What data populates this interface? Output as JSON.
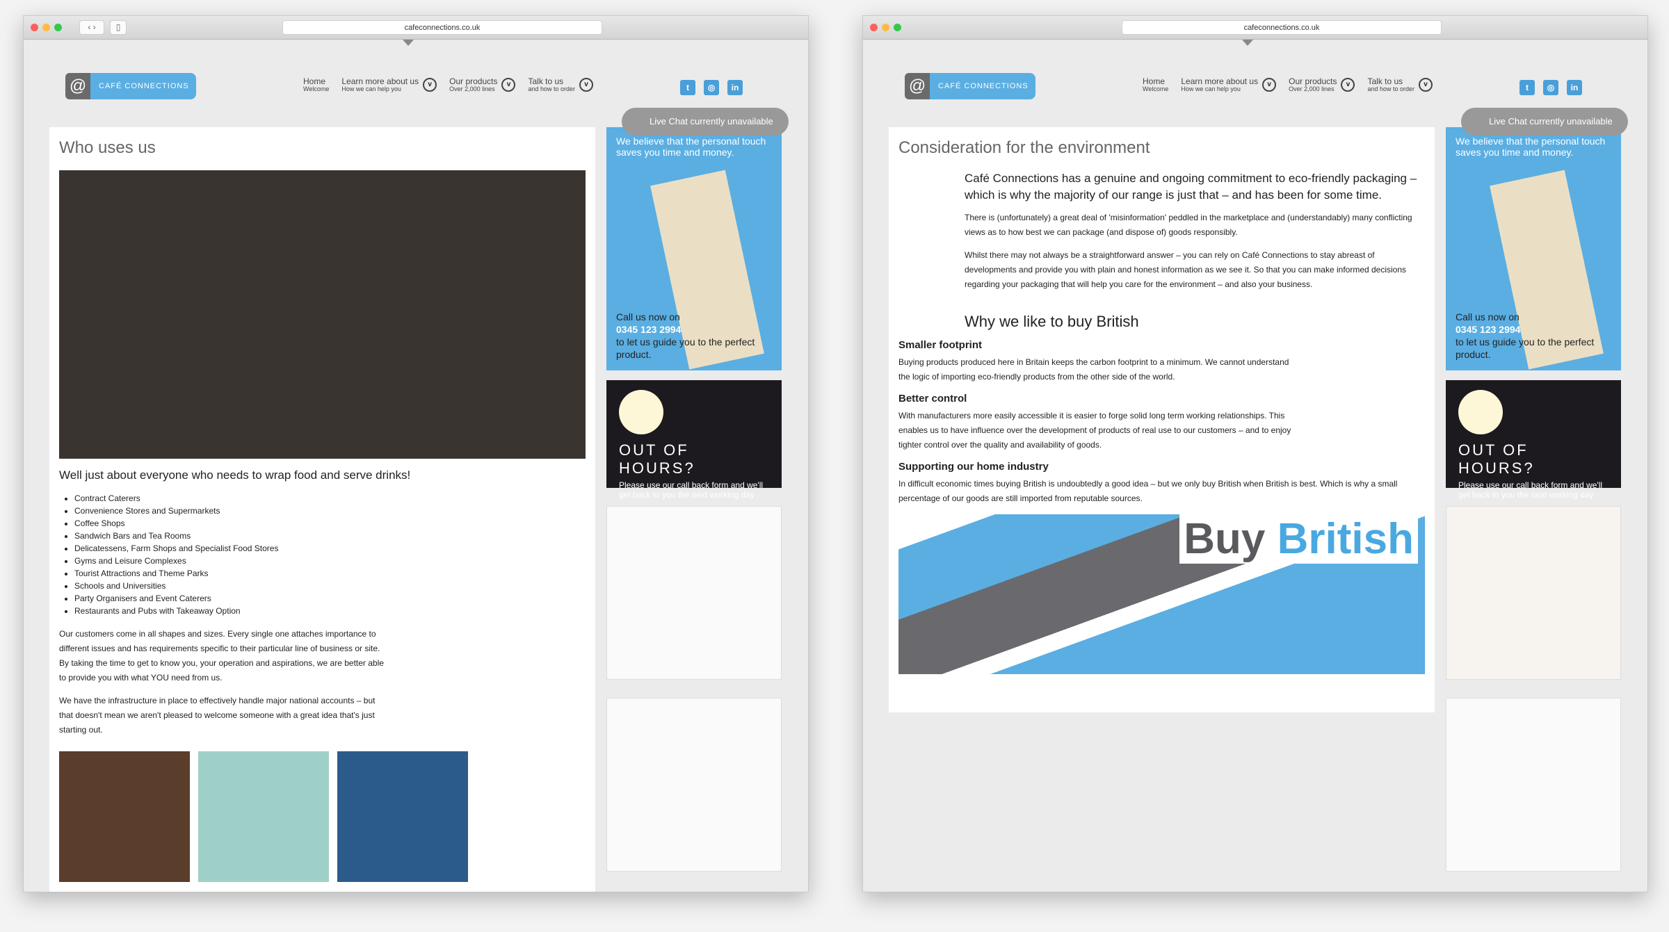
{
  "browser": {
    "url": "cafeconnections.co.uk"
  },
  "header": {
    "logo": "CAFÉ CONNECTIONS",
    "nav": [
      {
        "title": "Home",
        "sub": "Welcome"
      },
      {
        "title": "Learn more about us",
        "sub": "How we can help you"
      },
      {
        "title": "Our products",
        "sub": "Over 2,000 lines"
      },
      {
        "title": "Talk to us",
        "sub": "and how to order"
      }
    ],
    "social": [
      "twitter-icon",
      "instagram-icon",
      "linkedin-icon"
    ]
  },
  "chat": "Live Chat currently unavailable",
  "sidebar": {
    "blue_text": "We believe that the personal touch saves you time and money.",
    "call_prefix": "Call us now on",
    "phone": "0345 123 2994",
    "call_suffix": "to let us guide you to the perfect product.",
    "ooh_title": "OUT OF HOURS?",
    "ooh_text": "Please use our call back form and we'll get back to you the next working day"
  },
  "page1": {
    "title": "Who uses us",
    "lead": "Well just about everyone who needs to wrap food and serve drinks!",
    "list": [
      "Contract Caterers",
      "Convenience Stores and Supermarkets",
      "Coffee Shops",
      "Sandwich Bars and Tea Rooms",
      "Delicatessens, Farm Shops and Specialist Food Stores",
      "Gyms and Leisure Complexes",
      "Tourist Attractions and Theme Parks",
      "Schools and Universities",
      "Party Organisers and Event Caterers",
      "Restaurants and Pubs with Takeaway Option"
    ],
    "p1": "Our customers come in all shapes and sizes. Every single one attaches importance to different issues and has requirements specific to their particular line of business or site. By taking the time to get to know you, your operation and aspirations, we are better able to provide you with what YOU need from us.",
    "p2": "We have the infrastructure in place to effectively handle major national accounts – but that doesn't mean we aren't pleased to welcome someone with a great idea that's just starting out."
  },
  "page2": {
    "title": "Consideration for the environment",
    "lead": "Café Connections has a genuine and ongoing commitment to eco-friendly packaging – which is why the majority of our range is just that – and has been for some time.",
    "p1": "There is (unfortunately) a great deal of 'misinformation' peddled in the marketplace and (understandably) many conflicting views as to how best we can package (and dispose of) goods responsibly.",
    "p2": "Whilst there may not always be a straightforward answer – you can rely on Café Connections to stay abreast of developments and provide you with plain and honest information as we see it.  So that you can make informed decisions regarding your packaging that will help you care for the environment – and also your business.",
    "h2": "Why we like to buy British",
    "s1": "Smaller footprint",
    "s1p": "Buying products produced here in Britain keeps the carbon footprint to a minimum. We cannot understand the logic of importing eco-friendly products from the other side of the world.",
    "s2": "Better control",
    "s2p": "With manufacturers more easily accessible it is easier to forge solid long term working relationships. This enables us to have influence over the development of products of real use to our customers – and to enjoy tighter control over the quality and availability of goods.",
    "s3": "Supporting our home industry",
    "s3p": "In difficult economic times buying British is undoubtedly a good idea – but we only buy British when British is best. Which is why a small percentage of our goods are still imported from reputable sources.",
    "banner_a": "Buy",
    "banner_b": "British"
  }
}
